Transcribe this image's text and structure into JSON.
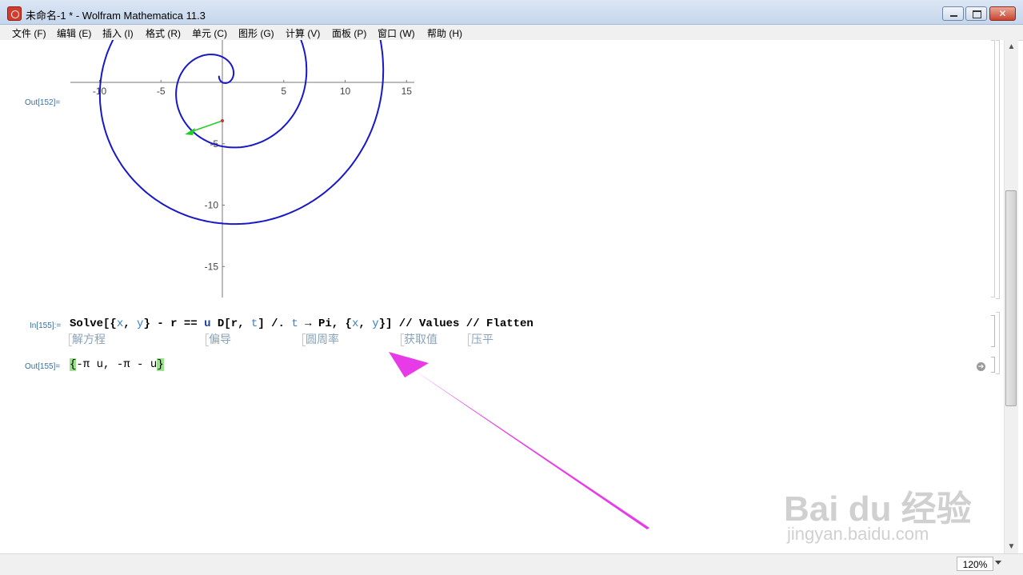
{
  "window": {
    "title": "未命名-1 * - Wolfram Mathematica 11.3"
  },
  "menu": [
    "文件 (F)",
    "编辑 (E)",
    "插入 (I)",
    "格式 (R)",
    "单元 (C)",
    "图形 (G)",
    "计算 (V)",
    "面板 (P)",
    "窗口 (W)",
    "帮助 (H)"
  ],
  "cells": {
    "out152_label": "Out[152]=",
    "in155_label": "In[155]:=",
    "out155_label": "Out[155]="
  },
  "plot": {
    "x_ticks": [
      "-10",
      "-5",
      "5",
      "10",
      "15"
    ],
    "y_ticks": [
      "-5",
      "-10",
      "-15"
    ],
    "axis_colors": {
      "curve": "#1818c8",
      "arrow": "#22cc22"
    }
  },
  "input": {
    "tokens": [
      {
        "t": "Solve",
        "c": "kw"
      },
      {
        "t": "[{",
        "c": "op"
      },
      {
        "t": "x",
        "c": "var"
      },
      {
        "t": ", ",
        "c": "op"
      },
      {
        "t": "y",
        "c": "var"
      },
      {
        "t": "} - ",
        "c": "op"
      },
      {
        "t": "r",
        "c": "op"
      },
      {
        "t": " == ",
        "c": "op"
      },
      {
        "t": "u",
        "c": "u"
      },
      {
        "t": " D[",
        "c": "op"
      },
      {
        "t": "r",
        "c": "op"
      },
      {
        "t": ", ",
        "c": "op"
      },
      {
        "t": "t",
        "c": "var"
      },
      {
        "t": "] /. ",
        "c": "op"
      },
      {
        "t": "t",
        "c": "var"
      },
      {
        "t": " → Pi, {",
        "c": "op"
      },
      {
        "t": "x",
        "c": "var"
      },
      {
        "t": ", ",
        "c": "op"
      },
      {
        "t": "y",
        "c": "var"
      },
      {
        "t": "}] // Values // Flatten",
        "c": "op"
      }
    ],
    "hints": [
      "解方程",
      "偏导",
      "圆周率",
      "获取值",
      "压平"
    ]
  },
  "output": {
    "open_brace": "{",
    "body": "-π u, -π - u",
    "close_brace": "}"
  },
  "status": {
    "zoom": "120%"
  },
  "watermark": {
    "main": "Bai du 经验",
    "sub": "jingyan.baidu.com"
  },
  "colors": {
    "annotation_arrow": "#e83be8",
    "label_blue": "#3a6f9e"
  }
}
